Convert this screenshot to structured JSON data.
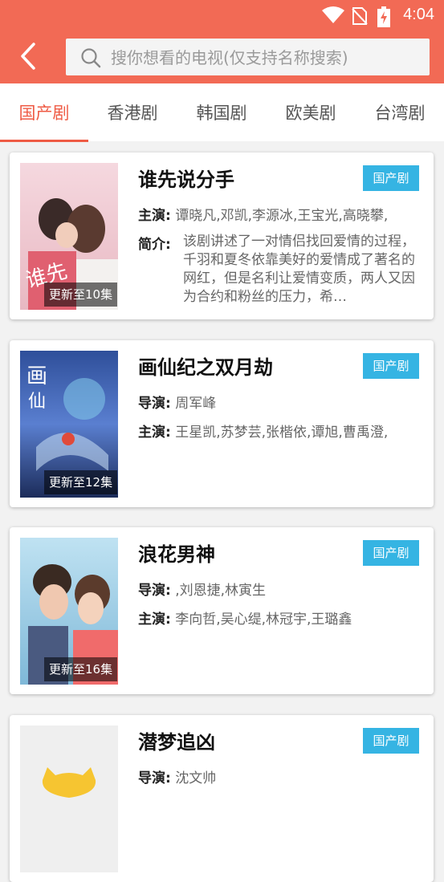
{
  "status": {
    "time": "4:04"
  },
  "search": {
    "placeholder": "搜你想看的电视(仅支持名称搜索)"
  },
  "tabs": [
    {
      "label": "国产剧",
      "active": true
    },
    {
      "label": "香港剧"
    },
    {
      "label": "韩国剧"
    },
    {
      "label": "欧美剧"
    },
    {
      "label": "台湾剧"
    }
  ],
  "items": [
    {
      "title": "谁先说分手",
      "badge": "国产剧",
      "update": "更新至10集",
      "row1_label": "主演:",
      "row1_value": "谭晓凡,邓凯,李源冰,王宝光,高晓攀,",
      "intro_label": "简介:",
      "intro_text": "该剧讲述了一对情侣找回爱情的过程，千羽和夏冬依靠美好的爱情成了著名的网红，但是名利让爱情变质，两人又因为合约和粉丝的压力，希…"
    },
    {
      "title": "画仙纪之双月劫",
      "badge": "国产剧",
      "update": "更新至12集",
      "row1_label": "导演:",
      "row1_value": "周军峰",
      "row2_label": "主演:",
      "row2_value": "王星凯,苏梦芸,张楷依,谭旭,曹禹澄,"
    },
    {
      "title": "浪花男神",
      "badge": "国产剧",
      "update": "更新至16集",
      "row1_label": "导演:",
      "row1_value": ",刘恩捷,林寅生",
      "row2_label": "主演:",
      "row2_value": "李向哲,吴心缇,林冠宇,王璐鑫"
    },
    {
      "title": "潜梦追凶",
      "badge": "国产剧",
      "row1_label": "导演:",
      "row1_value": "沈文帅"
    }
  ]
}
